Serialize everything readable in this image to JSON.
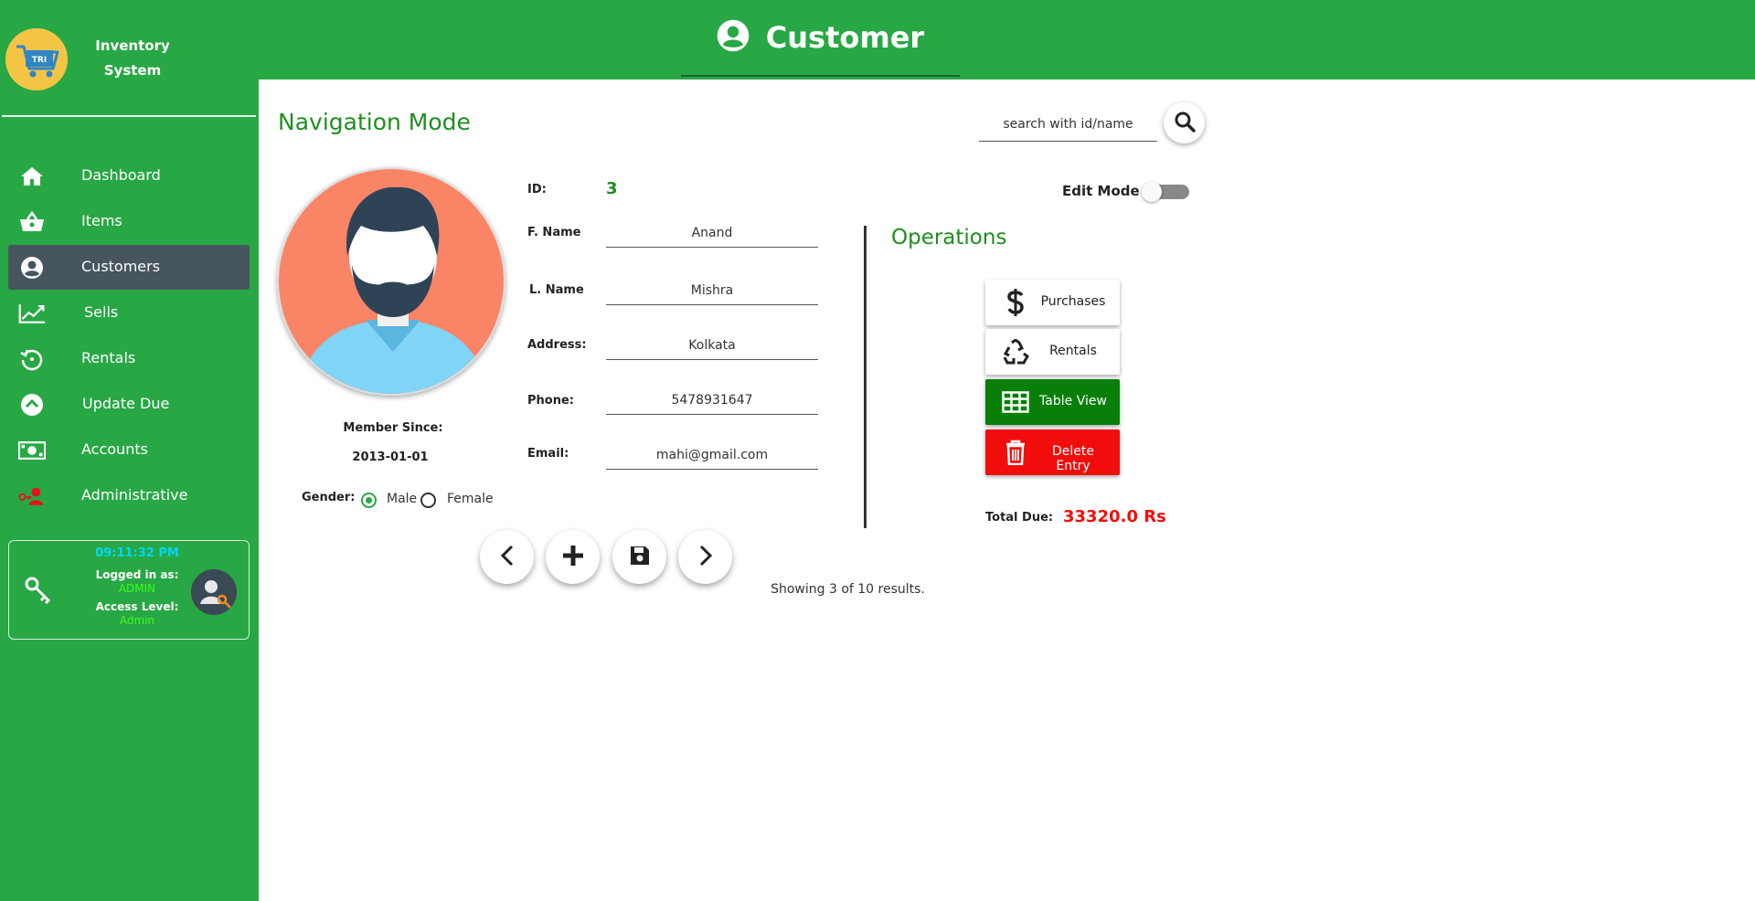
{
  "app": {
    "name_line1": "Inventory",
    "name_line2": "System",
    "logo_text": "TRI",
    "page_title": "Customer"
  },
  "sidebar": {
    "items": [
      {
        "label": "Dashboard",
        "icon": "home-icon"
      },
      {
        "label": "Items",
        "icon": "basket-icon"
      },
      {
        "label": "Customers",
        "icon": "user-circle-icon",
        "active": true
      },
      {
        "label": "Sells",
        "icon": "chart-line-icon"
      },
      {
        "label": "Rentals",
        "icon": "history-icon"
      },
      {
        "label": "Update Due",
        "icon": "chevron-up-circle-icon"
      },
      {
        "label": "Accounts",
        "icon": "money-icon"
      },
      {
        "label": "Administrative",
        "icon": "user-key-icon"
      }
    ]
  },
  "session": {
    "time": "09:11:32 PM",
    "logged_label": "Logged in as:",
    "logged_value": "ADMIN",
    "access_label": "Access Level:",
    "access_value": "Admin"
  },
  "main": {
    "mode_title": "Navigation Mode",
    "search_placeholder": "search with id/name",
    "member_since_label": "Member Since:",
    "member_since_value": "2013-01-01",
    "gender_label": "Gender:",
    "gender_options": [
      "Male",
      "Female"
    ],
    "gender_selected": "Male",
    "fields": {
      "id_label": "ID:",
      "id_value": "3",
      "fname_label": "F. Name",
      "fname_value": "Anand",
      "lname_label": "L. Name",
      "lname_value": "Mishra",
      "address_label": "Address:",
      "address_value": "Kolkata",
      "phone_label": "Phone:",
      "phone_value": "5478931647",
      "email_label": "Email:",
      "email_value": "mahi@gmail.com"
    },
    "edit_mode_label": "Edit Mode",
    "edit_mode_on": false,
    "operations_title": "Operations",
    "operations": [
      {
        "label": "Purchases",
        "icon": "dollar-icon"
      },
      {
        "label": "Rentals",
        "icon": "recycle-icon"
      },
      {
        "label": "Table View",
        "icon": "table-icon"
      },
      {
        "label": "Delete Entry",
        "icon": "trash-icon"
      }
    ],
    "total_due_label": "Total Due:",
    "total_due_value": "33320.0 Rs",
    "results_text": "Showing 3 of 10 results."
  },
  "colors": {
    "brand_green": "#28a745",
    "active_nav": "#46555e",
    "title_green": "#1e8f1e",
    "danger": "#f20d0d",
    "table_view_green": "#087f08",
    "time_cyan": "#00d7ff",
    "status_lime": "#39ff14"
  }
}
